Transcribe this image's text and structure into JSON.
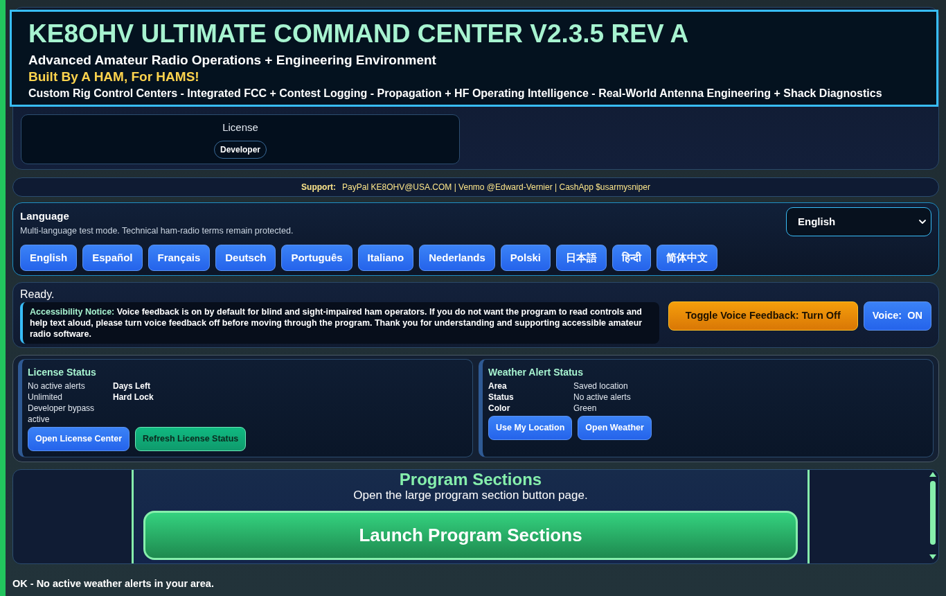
{
  "header": {
    "title": "KE8OHV ULTIMATE COMMAND CENTER V2.3.5 REV A",
    "subtitle": "Advanced Amateur Radio Operations + Engineering Environment",
    "motto": "Built By A HAM, For HAMS!",
    "tagline": "Custom Rig Control Centers - Integrated FCC + Contest Logging - Propagation + HF Operating Intelligence - Real-World Antenna Engineering + Shack Diagnostics"
  },
  "license_card": {
    "label": "License",
    "badge": "Developer"
  },
  "support": {
    "label": "Support:",
    "text": "PayPal KE8OHV@USA.COM | Venmo @Edward-Vernier | CashApp $usarmysniper"
  },
  "language": {
    "title": "Language",
    "description": "Multi-language test mode. Technical ham-radio terms remain protected.",
    "select": {
      "value": "English"
    },
    "buttons": [
      "English",
      "Español",
      "Français",
      "Deutsch",
      "Português",
      "Italiano",
      "Nederlands",
      "Polski",
      "日本語",
      "हिन्दी",
      "简体中文"
    ]
  },
  "status": {
    "message": "Ready.",
    "notice": {
      "label": "Accessibility Notice:",
      "text": "Voice feedback is on by default for blind and sight-impaired ham operators. If you do not want the program to read controls and help text aloud, please turn voice feedback off before moving through the program. Thank you for understanding and supporting accessible amateur radio software."
    },
    "buttons": [
      {
        "label": "Toggle Voice Feedback: Turn Off",
        "kind": "warning"
      },
      {
        "label": "Voice:  ON",
        "kind": "primary"
      }
    ]
  },
  "license_status": {
    "title": "License Status",
    "column_1": [
      "No active alerts",
      "Unlimited",
      "Developer bypass active"
    ],
    "column_2": [
      "Days Left",
      "Hard Lock"
    ],
    "buttons": [
      {
        "label": "Open License Center",
        "kind": "primary"
      },
      {
        "label": "Refresh License Status",
        "kind": "success"
      }
    ]
  },
  "weather_status": {
    "title": "Weather Alert Status",
    "rows": [
      {
        "label": "Area",
        "value": "Saved location"
      },
      {
        "label": "Status",
        "value": "No active alerts"
      },
      {
        "label": "Color",
        "value": "Green"
      }
    ],
    "buttons": [
      {
        "label": "Use My Location",
        "kind": "primary"
      },
      {
        "label": "Open Weather",
        "kind": "primary"
      }
    ]
  },
  "program_sections": {
    "title": "Program Sections",
    "description": "Open the large program section button page.",
    "button": "Launch Program Sections"
  },
  "status_bar": "OK - No active weather alerts in your area."
}
